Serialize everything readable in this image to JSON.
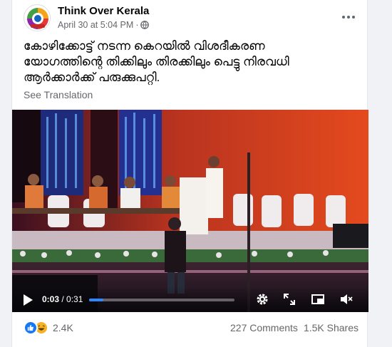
{
  "post": {
    "page_name": "Think Over Kerala",
    "timestamp": "April 30 at 5:04 PM",
    "dot": "·",
    "privacy_icon": "globe-icon",
    "more_icon": "more-options-icon",
    "text_lines": [
      "കോഴിക്കോട്ട് നടന്ന കെറയിൽ വിശദീകരണ",
      "യോഗത്തിന്റെ തിക്കിലും തിരക്കിലും പെട്ടു നിരവധി",
      "ആർക്കാർക്ക് പരുക്കുപറ്റി."
    ],
    "see_translation": "See Translation"
  },
  "video": {
    "current_time": "0:03",
    "separator": " / ",
    "duration": "0:31",
    "progress_fraction": 0.097,
    "icons": [
      "play-icon",
      "settings-icon",
      "fullscreen-expand-icon",
      "picture-in-picture-icon",
      "volume-muted-icon"
    ]
  },
  "footer": {
    "reaction_count": "2.4K",
    "comments": "227 Comments",
    "shares": "1.5K Shares",
    "reactions": [
      "like-icon",
      "haha-icon"
    ]
  },
  "colors": {
    "accent": "#1877f2",
    "progress": "#2d88ff",
    "secondary_text": "#65676b",
    "haha": "#f7b125"
  }
}
